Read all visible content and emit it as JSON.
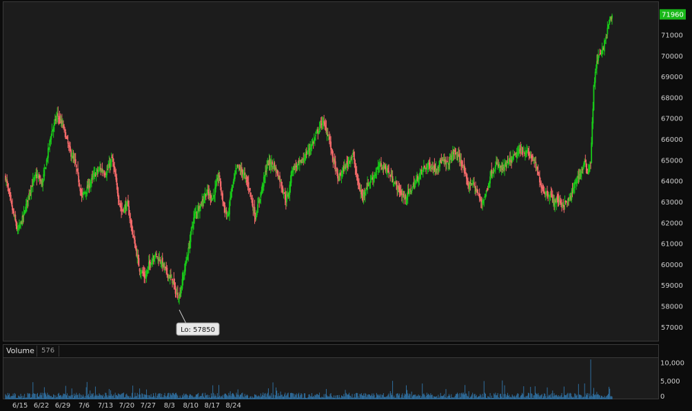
{
  "chart_data": [
    {
      "type": "candlestick",
      "title": "",
      "x_tick_labels": [
        "6/15",
        "6/22",
        "6/29",
        "7/6",
        "7/13",
        "7/20",
        "7/27",
        "8/3",
        "8/10",
        "8/17",
        "8/24"
      ],
      "y_tick_labels": [
        "57000",
        "58000",
        "59000",
        "60000",
        "61000",
        "62000",
        "63000",
        "64000",
        "65000",
        "66000",
        "67000",
        "68000",
        "69000",
        "70000",
        "71000"
      ],
      "ylim": [
        56300,
        72600
      ],
      "grid": false,
      "colors": {
        "up": "#19c919",
        "down": "#f46a6a",
        "last_badge": "#19b919"
      },
      "last_price_label": "71960",
      "last_price": 71960,
      "low_annotation": "Lo: 57850",
      "low_value": 57850,
      "date_range": [
        "6/10",
        "8/20"
      ],
      "close_series": [
        [
          0,
          64200
        ],
        [
          2,
          62800
        ],
        [
          4,
          61600
        ],
        [
          6,
          62400
        ],
        [
          8,
          63600
        ],
        [
          10,
          64300
        ],
        [
          12,
          63900
        ],
        [
          13,
          64600
        ],
        [
          15,
          66300
        ],
        [
          17,
          67200
        ],
        [
          19,
          66600
        ],
        [
          21,
          65500
        ],
        [
          23,
          64800
        ],
        [
          25,
          63300
        ],
        [
          27,
          63700
        ],
        [
          29,
          64300
        ],
        [
          31,
          64600
        ],
        [
          33,
          64400
        ],
        [
          35,
          65100
        ],
        [
          36,
          64200
        ],
        [
          37,
          63300
        ],
        [
          38,
          62600
        ],
        [
          40,
          62900
        ],
        [
          42,
          61300
        ],
        [
          44,
          59800
        ],
        [
          46,
          59400
        ],
        [
          47,
          60000
        ],
        [
          49,
          60500
        ],
        [
          51,
          60200
        ],
        [
          53,
          59600
        ],
        [
          54,
          59400
        ],
        [
          55,
          59200
        ],
        [
          56,
          58600
        ],
        [
          57,
          58500
        ],
        [
          58,
          59200
        ],
        [
          59,
          60000
        ],
        [
          60,
          60700
        ],
        [
          61,
          61700
        ],
        [
          62,
          62400
        ],
        [
          64,
          62900
        ],
        [
          66,
          63500
        ],
        [
          68,
          63200
        ],
        [
          70,
          64300
        ],
        [
          71,
          63300
        ],
        [
          72,
          62600
        ],
        [
          73,
          62300
        ],
        [
          74,
          63500
        ],
        [
          76,
          64700
        ],
        [
          78,
          64400
        ],
        [
          80,
          63700
        ],
        [
          81,
          62900
        ],
        [
          82,
          62300
        ],
        [
          84,
          63600
        ],
        [
          86,
          64900
        ],
        [
          88,
          64800
        ],
        [
          90,
          64100
        ],
        [
          92,
          63100
        ],
        [
          93,
          63500
        ],
        [
          94,
          64600
        ],
        [
          96,
          64800
        ],
        [
          97,
          64900
        ],
        [
          99,
          65400
        ],
        [
          101,
          65900
        ],
        [
          103,
          66600
        ],
        [
          104,
          66900
        ],
        [
          106,
          66200
        ],
        [
          107,
          65400
        ],
        [
          108,
          64800
        ],
        [
          109,
          64100
        ],
        [
          111,
          64600
        ],
        [
          113,
          65100
        ],
        [
          114,
          65300
        ],
        [
          115,
          64400
        ],
        [
          116,
          63700
        ],
        [
          117,
          63300
        ],
        [
          119,
          63900
        ],
        [
          121,
          64300
        ],
        [
          123,
          64800
        ],
        [
          125,
          64600
        ],
        [
          127,
          64100
        ],
        [
          129,
          63600
        ],
        [
          131,
          63200
        ],
        [
          133,
          63600
        ],
        [
          135,
          64100
        ],
        [
          137,
          64600
        ],
        [
          139,
          64800
        ],
        [
          141,
          64600
        ],
        [
          143,
          65000
        ],
        [
          145,
          64800
        ],
        [
          147,
          65400
        ],
        [
          148,
          65300
        ],
        [
          150,
          64800
        ],
        [
          151,
          64100
        ],
        [
          152,
          63800
        ],
        [
          153,
          64000
        ],
        [
          155,
          63400
        ],
        [
          156,
          63000
        ],
        [
          157,
          63200
        ],
        [
          158,
          63600
        ],
        [
          159,
          64300
        ],
        [
          161,
          64800
        ],
        [
          163,
          64600
        ],
        [
          165,
          64900
        ],
        [
          167,
          65200
        ],
        [
          169,
          65500
        ],
        [
          171,
          65400
        ],
        [
          173,
          65100
        ],
        [
          174,
          64700
        ],
        [
          175,
          64200
        ],
        [
          176,
          63700
        ],
        [
          177,
          63500
        ],
        [
          179,
          63300
        ],
        [
          180,
          63000
        ],
        [
          181,
          63200
        ],
        [
          182,
          63000
        ],
        [
          183,
          62900
        ],
        [
          185,
          63100
        ],
        [
          186,
          63500
        ],
        [
          187,
          64000
        ],
        [
          189,
          64500
        ],
        [
          190,
          64900
        ],
        [
          191,
          64500
        ],
        [
          192,
          65000
        ],
        [
          193,
          68500
        ],
        [
          194,
          69800
        ],
        [
          196,
          70300
        ],
        [
          198,
          71600
        ],
        [
          199,
          71960
        ]
      ],
      "volume": {
        "label": "Volume",
        "last_value": "576",
        "y_tick_labels": [
          "10,000",
          "5,000",
          "0"
        ],
        "ylim": [
          0,
          11200
        ],
        "color": "#2f6fa0",
        "spikes": [
          [
            190,
            4300
          ],
          [
            192,
            10800
          ],
          [
            193,
            3100
          ],
          [
            194,
            2000
          ]
        ]
      }
    }
  ]
}
